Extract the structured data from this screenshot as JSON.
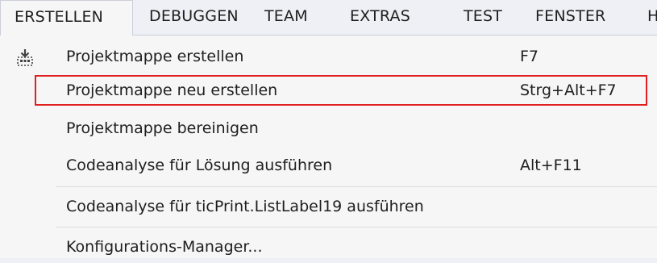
{
  "menubar": {
    "items": [
      {
        "label": "ERSTELLEN",
        "active": true
      },
      {
        "label": "DEBUGGEN"
      },
      {
        "label": "TEAM"
      },
      {
        "label": "EXTRAS"
      },
      {
        "label": "TEST"
      },
      {
        "label": "FENSTER"
      },
      {
        "label": "H"
      }
    ]
  },
  "dropdown": {
    "items": [
      {
        "label": "Projektmappe erstellen",
        "shortcut": "F7",
        "icon": "build-solution-icon"
      },
      {
        "label": "Projektmappe neu erstellen",
        "shortcut": "Strg+Alt+F7",
        "highlighted": true
      },
      {
        "label": "Projektmappe bereinigen",
        "shortcut": ""
      },
      {
        "label": "Codeanalyse für Lösung ausführen",
        "shortcut": "Alt+F11"
      },
      {
        "label": "Codeanalyse für ticPrint.ListLabel19 ausführen",
        "shortcut": ""
      },
      {
        "label": "Konfigurations-Manager...",
        "shortcut": ""
      }
    ]
  },
  "colors": {
    "menu_background": "#eef0f5",
    "dropdown_background": "#f6f6f6",
    "highlight_border": "#e02020",
    "text": "#1e1e1e"
  }
}
